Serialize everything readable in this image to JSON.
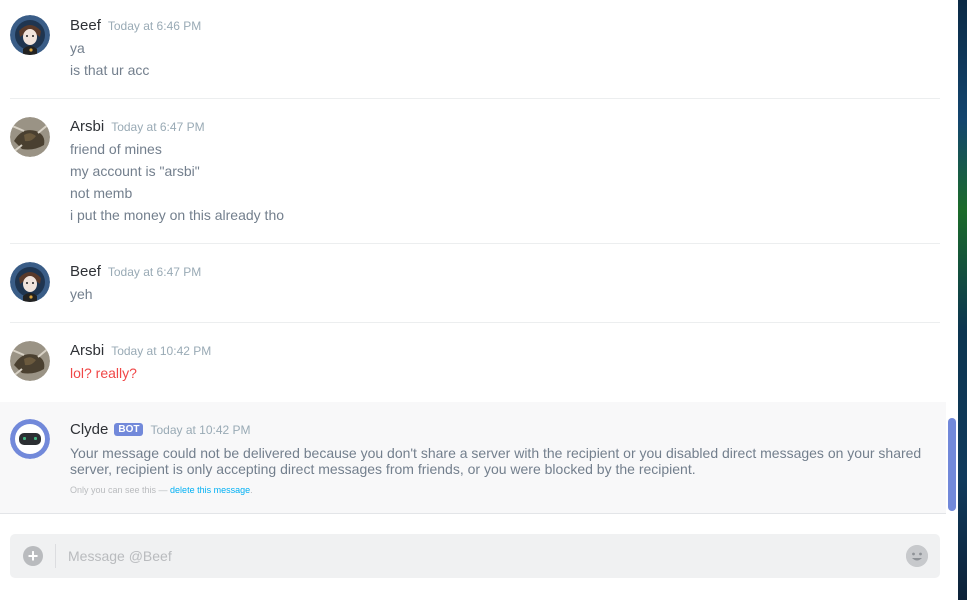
{
  "messages": [
    {
      "author": "Beef",
      "timestamp": "Today at 6:46 PM",
      "lines": [
        "ya",
        "is that ur acc"
      ]
    },
    {
      "author": "Arsbi",
      "timestamp": "Today at 6:47 PM",
      "lines": [
        "friend of mines",
        "my account is \"arsbi\"",
        "not memb",
        "i put the money on this already tho"
      ]
    },
    {
      "author": "Beef",
      "timestamp": "Today at 6:47 PM",
      "lines": [
        "yeh"
      ]
    },
    {
      "author": "Arsbi",
      "timestamp": "Today at 10:42 PM",
      "lines": [
        "lol? really?"
      ]
    }
  ],
  "clyde": {
    "author": "Clyde",
    "tag": "BOT",
    "timestamp": "Today at 10:42 PM",
    "body": "Your message could not be delivered because you don't share a server with the recipient or you disabled direct messages on your shared server, recipient is only accepting direct messages from friends, or you were blocked by the recipient.",
    "note_prefix": "Only you can see this — ",
    "note_link": "delete this message",
    "note_suffix": "."
  },
  "composer": {
    "placeholder": "Message @Beef",
    "attach_icon": "+"
  },
  "colors": {
    "accent": "#7289da",
    "failed_message": "#f04747",
    "link": "#00b0f4"
  }
}
